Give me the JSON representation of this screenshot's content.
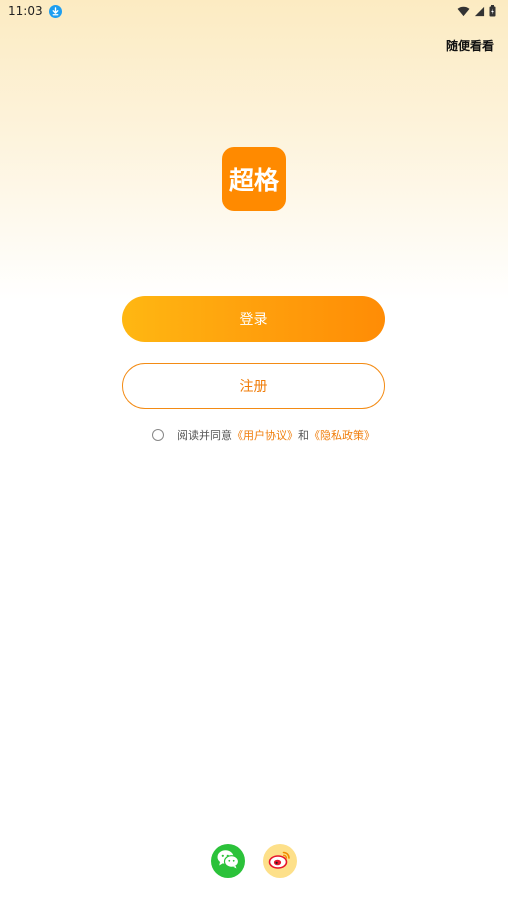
{
  "status_bar": {
    "time": "11:03",
    "download_icon": "download-icon",
    "wifi_icon": "wifi-icon",
    "signal_icon": "signal-icon",
    "battery_icon": "battery-icon"
  },
  "header": {
    "browse_label": "随便看看"
  },
  "logo": {
    "text": "超格",
    "color": "#ff8a00"
  },
  "actions": {
    "login_label": "登录",
    "register_label": "注册",
    "accent": "#ff8c05"
  },
  "agreement": {
    "prefix": "阅读并同意",
    "user_agreement": "《用户协议》",
    "conjunction": "和",
    "privacy_policy": "《隐私政策》"
  },
  "social_login": {
    "wechat_icon": "wechat-icon",
    "weibo_icon": "weibo-icon"
  }
}
